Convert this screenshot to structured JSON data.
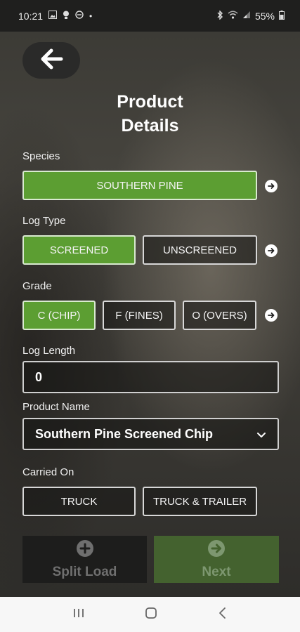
{
  "status_bar": {
    "time": "10:21",
    "dot": "•",
    "battery": "55%"
  },
  "header": {
    "title_line1": "Product",
    "title_line2": "Details"
  },
  "species": {
    "label": "Species",
    "options": [
      "SOUTHERN PINE"
    ],
    "selected": "SOUTHERN PINE"
  },
  "log_type": {
    "label": "Log Type",
    "options": [
      "SCREENED",
      "UNSCREENED"
    ],
    "selected": "SCREENED"
  },
  "grade": {
    "label": "Grade",
    "options": [
      "C (CHIP)",
      "F (FINES)",
      "O (OVERS)"
    ],
    "selected": "C (CHIP)"
  },
  "log_length": {
    "label": "Log Length",
    "value": "0"
  },
  "product_name": {
    "label": "Product Name",
    "value": "Southern Pine Screened Chip"
  },
  "carried_on": {
    "label": "Carried On",
    "options": [
      "TRUCK",
      "TRUCK & TRAILER"
    ]
  },
  "actions": {
    "split_load": "Split Load",
    "next": "Next"
  },
  "colors": {
    "selected_green": "#5c9e32",
    "next_disabled": "#44622f"
  },
  "icons": {
    "back": "arrow-left-icon",
    "row_arrow": "arrow-right-circle-icon",
    "split": "plus-circle-icon",
    "next": "arrow-right-circle-icon",
    "dropdown": "chevron-down-icon"
  }
}
